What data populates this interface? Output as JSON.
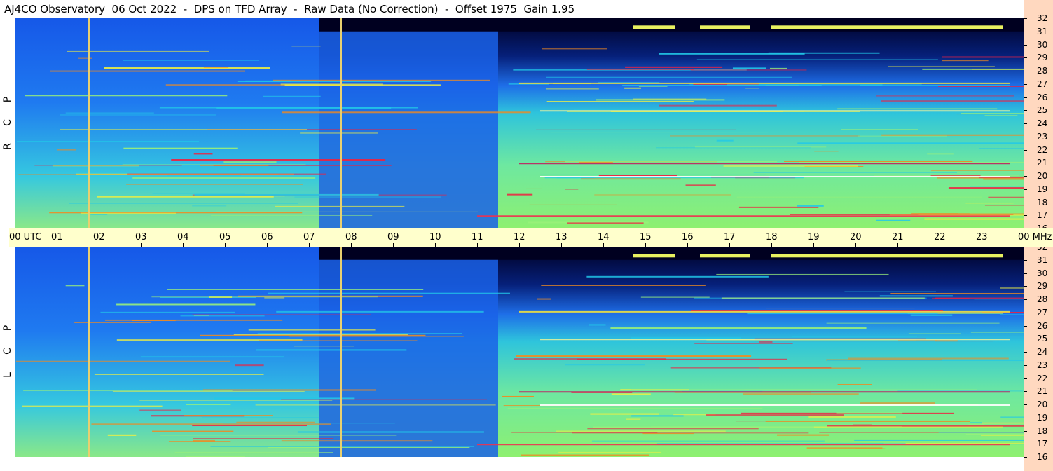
{
  "title": "AJ4CO Observatory  06 Oct 2022  -  DPS on TFD Array  -  Raw Data (No Correction)  -  Offset 1975  Gain 1.95",
  "panels": [
    {
      "name": "RCP",
      "letters": [
        "R",
        "C",
        "P"
      ]
    },
    {
      "name": "LCP",
      "letters": [
        "L",
        "C",
        "P"
      ]
    }
  ],
  "time_axis": {
    "start_label": "00 UTC",
    "labels": [
      "01",
      "02",
      "03",
      "04",
      "05",
      "06",
      "07",
      "08",
      "09",
      "10",
      "11",
      "12",
      "13",
      "14",
      "15",
      "16",
      "17",
      "18",
      "19",
      "20",
      "21",
      "22",
      "23"
    ],
    "end_label": "00 MHz"
  },
  "freq_axis": {
    "labels": [
      "32",
      "31",
      "30",
      "29",
      "28",
      "27",
      "26",
      "25",
      "24",
      "23",
      "22",
      "21",
      "20",
      "19",
      "18",
      "17",
      "16"
    ]
  },
  "chart_data": {
    "type": "heatmap",
    "title": "AJ4CO Observatory  06 Oct 2022  -  DPS on TFD Array  -  Raw Data (No Correction)  -  Offset 1975  Gain 1.95",
    "x": {
      "label": "UTC",
      "unit": "hour",
      "range": [
        0,
        24
      ]
    },
    "y": {
      "label": "MHz",
      "range": [
        16,
        32
      ],
      "ticks": [
        16,
        17,
        18,
        19,
        20,
        21,
        22,
        23,
        24,
        25,
        26,
        27,
        28,
        29,
        30,
        31,
        32
      ]
    },
    "panels": [
      "RCP",
      "LCP"
    ],
    "colormap": [
      "#000024",
      "#00104a",
      "#0a3bd0",
      "#1a78f0",
      "#22c8e8",
      "#9af07a",
      "#f0f040",
      "#f08a20",
      "#f02040",
      "#ffffff"
    ],
    "vertical_markers_utc": [
      1.75,
      7.75
    ],
    "dark_region_utc": [
      7.25,
      24
    ]
  }
}
